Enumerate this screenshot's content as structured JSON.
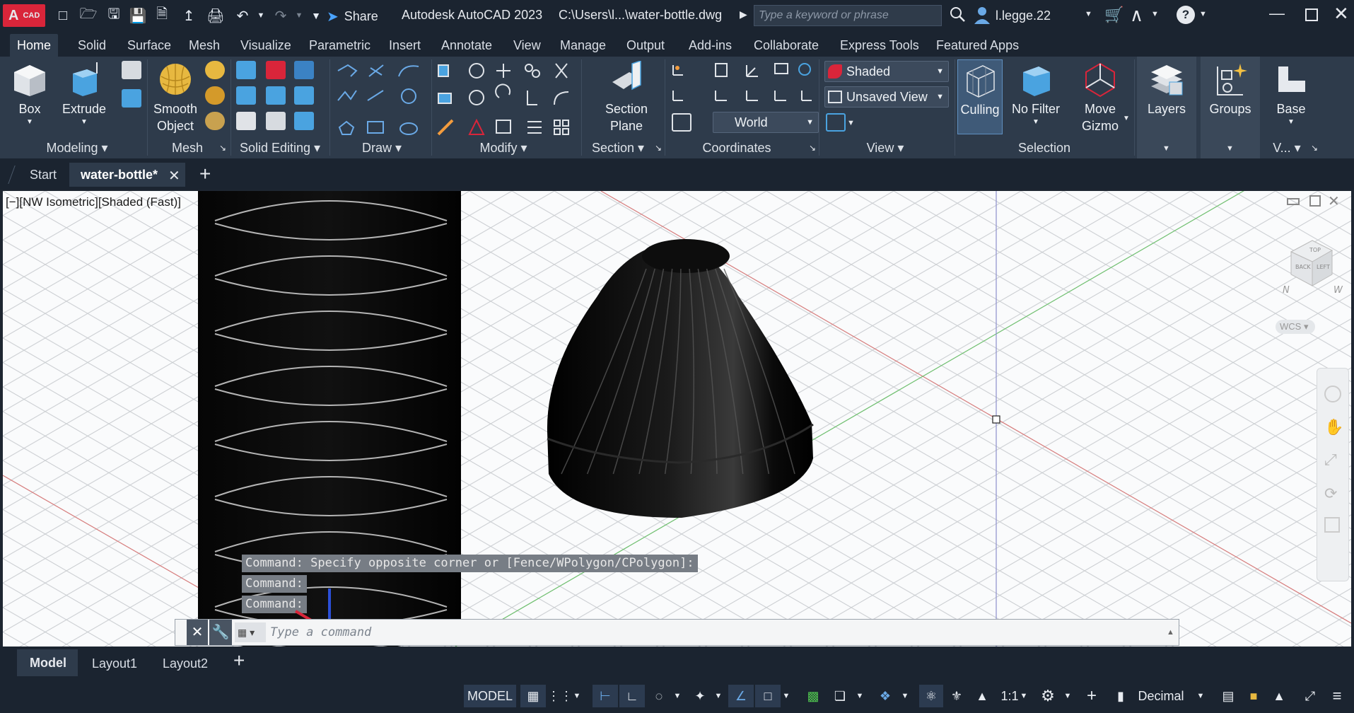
{
  "app": {
    "logo_text": "A",
    "logo_sub": "CAD",
    "title": "Autodesk AutoCAD 2023",
    "file_path": "C:\\Users\\l...\\water-bottle.dwg",
    "share_label": "Share",
    "search_placeholder": "Type a keyword or phrase",
    "user_name": "l.legge.22"
  },
  "ribbon_tabs": [
    "Home",
    "Solid",
    "Surface",
    "Mesh",
    "Visualize",
    "Parametric",
    "Insert",
    "Annotate",
    "View",
    "Manage",
    "Output",
    "Add-ins",
    "Collaborate",
    "Express Tools",
    "Featured Apps"
  ],
  "ribbon": {
    "modeling": {
      "box": "Box",
      "extrude": "Extrude",
      "title": "Modeling"
    },
    "mesh": {
      "smooth_1": "Smooth",
      "smooth_2": "Object",
      "title": "Mesh"
    },
    "solid_editing": {
      "title": "Solid Editing"
    },
    "draw": {
      "title": "Draw"
    },
    "modify": {
      "title": "Modify"
    },
    "section": {
      "plane_1": "Section",
      "plane_2": "Plane",
      "title": "Section"
    },
    "coordinates": {
      "world": "World",
      "title": "Coordinates"
    },
    "view": {
      "visual_style": "Shaded",
      "named_view": "Unsaved View",
      "title": "View"
    },
    "selection": {
      "culling": "Culling",
      "no_filter": "No Filter",
      "gizmo_1": "Move",
      "gizmo_2": "Gizmo",
      "title": "Selection"
    },
    "layers": "Layers",
    "groups": "Groups",
    "base": "Base",
    "base_title": "V..."
  },
  "doc_tabs": {
    "start": "Start",
    "active": "water-bottle*"
  },
  "viewport": {
    "label": "[−][NW Isometric][Shaded (Fast)]",
    "viewcube_top": "TOP",
    "viewcube_back": "BACK",
    "viewcube_left": "LEFT",
    "compass_n": "N",
    "compass_w": "W",
    "ucs_label": "WCS"
  },
  "command": {
    "history": [
      "Command: Specify opposite corner or [Fence/WPolygon/CPolygon]:",
      "Command:",
      "Command:"
    ],
    "placeholder": "Type a command"
  },
  "layout_tabs": [
    "Model",
    "Layout1",
    "Layout2"
  ],
  "status": {
    "model": "MODEL",
    "scale": "1:1",
    "units": "Decimal"
  },
  "colors": {
    "accent": "#4aa3ff",
    "ribbon_bg": "#2e3b4b",
    "title_bg": "#1b2430",
    "logo_red": "#d9253a"
  }
}
